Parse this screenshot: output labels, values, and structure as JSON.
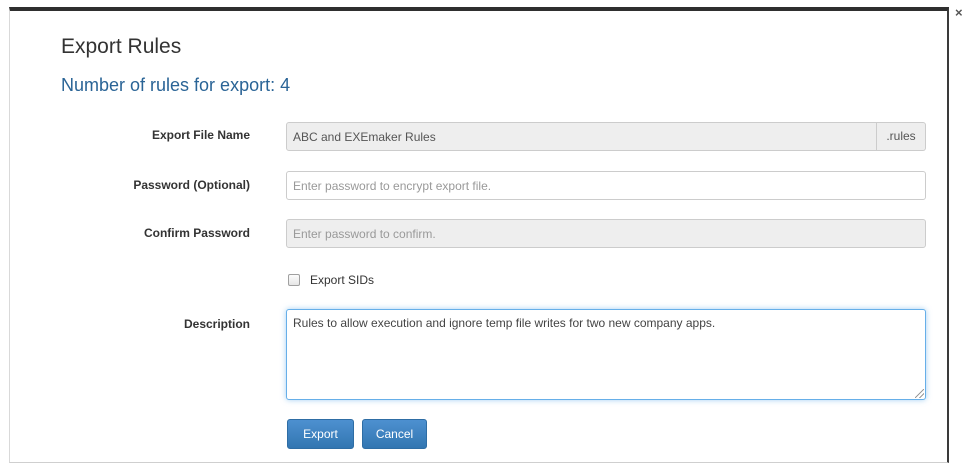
{
  "dialog": {
    "title": "Export Rules",
    "subtitle": "Number of rules for export: 4",
    "close_symbol": "×"
  },
  "form": {
    "file_name": {
      "label": "Export File Name",
      "value": "ABC and EXEmaker Rules",
      "suffix": ".rules"
    },
    "password": {
      "label": "Password (Optional)",
      "placeholder": "Enter password to encrypt export file."
    },
    "confirm_password": {
      "label": "Confirm Password",
      "placeholder": "Enter password to confirm."
    },
    "export_sids": {
      "label": "Export SIDs",
      "checked": false
    },
    "description": {
      "label": "Description",
      "value": "Rules to allow execution and ignore temp file writes for two new company apps."
    }
  },
  "buttons": {
    "export": "Export",
    "cancel": "Cancel"
  },
  "colors": {
    "primary_button": "#3276b1",
    "subtitle_text": "#2a6496",
    "focus_border": "#66afe9"
  }
}
